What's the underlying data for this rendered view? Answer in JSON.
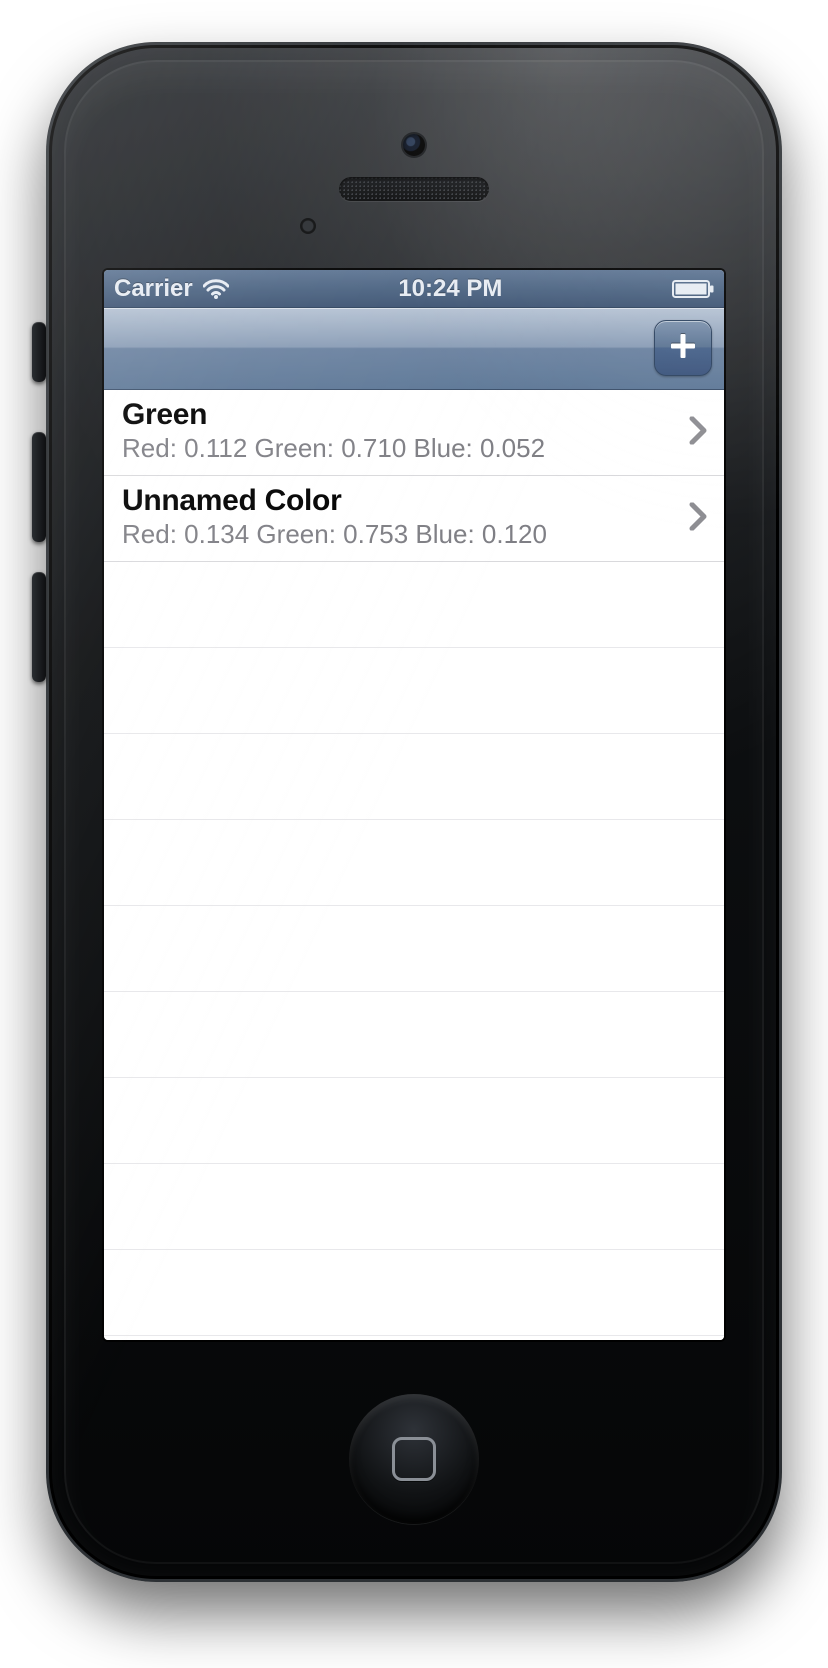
{
  "status": {
    "carrier": "Carrier",
    "time": "10:24 PM"
  },
  "navbar": {
    "add_icon": "plus-icon"
  },
  "colors": [
    {
      "name": "Green",
      "detail": "Red: 0.112 Green: 0.710 Blue: 0.052"
    },
    {
      "name": "Unnamed Color",
      "detail": "Red: 0.134 Green: 0.753 Blue: 0.120"
    }
  ]
}
